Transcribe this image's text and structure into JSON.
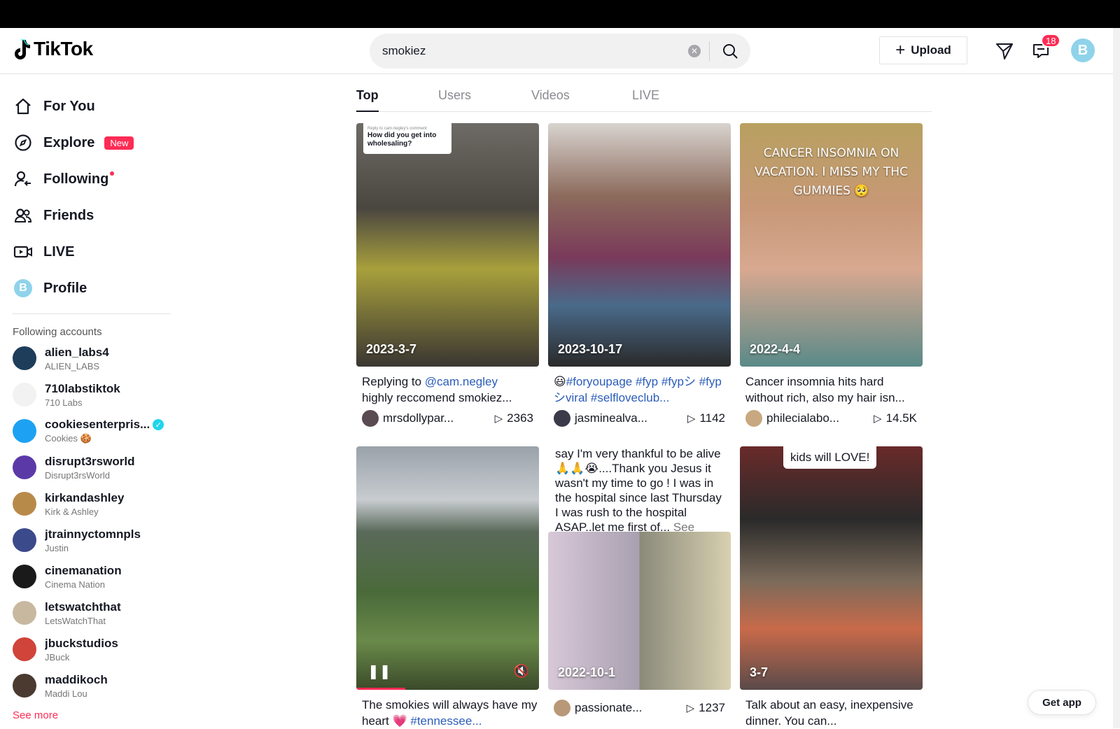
{
  "header": {
    "logo_text": "TikTok",
    "search_value": "smokiez",
    "upload_label": "Upload",
    "inbox_count": "18",
    "avatar_letter": "B"
  },
  "sidebar": {
    "nav": [
      {
        "label": "For You",
        "icon": "home-icon"
      },
      {
        "label": "Explore",
        "icon": "compass-icon",
        "badge": "New"
      },
      {
        "label": "Following",
        "icon": "following-icon"
      },
      {
        "label": "Friends",
        "icon": "friends-icon"
      },
      {
        "label": "LIVE",
        "icon": "live-icon"
      },
      {
        "label": "Profile",
        "icon": "profile-avatar",
        "avatar_letter": "B"
      }
    ],
    "following_title": "Following accounts",
    "accounts": [
      {
        "name": "alien_labs4",
        "sub": "ALIEN_LABS",
        "color": "#1e3d5a"
      },
      {
        "name": "710labstiktok",
        "sub": "710 Labs",
        "color": "#f2f2f2"
      },
      {
        "name": "cookiesenterpris...",
        "sub": "Cookies 🍪",
        "color": "#1da1f2",
        "verified": true
      },
      {
        "name": "disrupt3rsworld",
        "sub": "Disrupt3rsWorld",
        "color": "#5b3aa8"
      },
      {
        "name": "kirkandashley",
        "sub": "Kirk & Ashley",
        "color": "#b88a4a"
      },
      {
        "name": "jtrainnyctomnpls",
        "sub": "Justin",
        "color": "#3b4a8a"
      },
      {
        "name": "cinemanation",
        "sub": "Cinema Nation",
        "color": "#1a1a1a"
      },
      {
        "name": "letswatchthat",
        "sub": "LetsWatchThat",
        "color": "#c8b8a0"
      },
      {
        "name": "jbuckstudios",
        "sub": "JBuck",
        "color": "#d0443a"
      },
      {
        "name": "maddikoch",
        "sub": "Maddi Lou",
        "color": "#4a3a30"
      }
    ],
    "see_more": "See more"
  },
  "tabs": [
    "Top",
    "Users",
    "Videos",
    "LIVE"
  ],
  "cards": [
    {
      "date": "2023-3-7",
      "reply_small": "Reply to cam.negley's comment",
      "reply_text": "How did you get into wholesaling?",
      "cap_prefix": "Replying to ",
      "cap_mention": "@cam.negley",
      "cap_rest": "highly reccomend smokiez...",
      "user": "mrsdollypar...",
      "views": "2363"
    },
    {
      "date": "2023-10-17",
      "cap_emoji": "😃",
      "cap_tags": "#foryoupage #fyp #fypシ #fypシviral #selfloveclub...",
      "user": "jasminealva...",
      "views": "1142"
    },
    {
      "date": "2022-4-4",
      "overlay": "CANCER INSOMNIA ON VACATION. I MISS MY THC GUMMIES 🥺",
      "cap": "Cancer insomnia hits hard without rich, also my hair isn...",
      "user": "philecialabo...",
      "views": "14.5K"
    },
    {
      "cap_text": "The smokies will always have my heart 💗 ",
      "cap_tag": "#tennessee..."
    },
    {
      "text_top": "say I'm very thankful to be alive 🙏🙏😭....Thank you Jesus it wasn't my time to go ! I was in the hospital since last Thursday I was rush to the hospital ASAP..let me first of...",
      "see_more": "See more",
      "date": "2022-10-1",
      "user": "passionate...",
      "views": "1237"
    },
    {
      "kids": "kids will LOVE!",
      "date": "3-7",
      "cap": "Talk about an easy, inexpensive dinner. You can..."
    }
  ],
  "get_app": "Get app",
  "colors": {
    "accent": "#fe2c55",
    "link": "#2b5db9",
    "verified": "#20d5ec"
  }
}
